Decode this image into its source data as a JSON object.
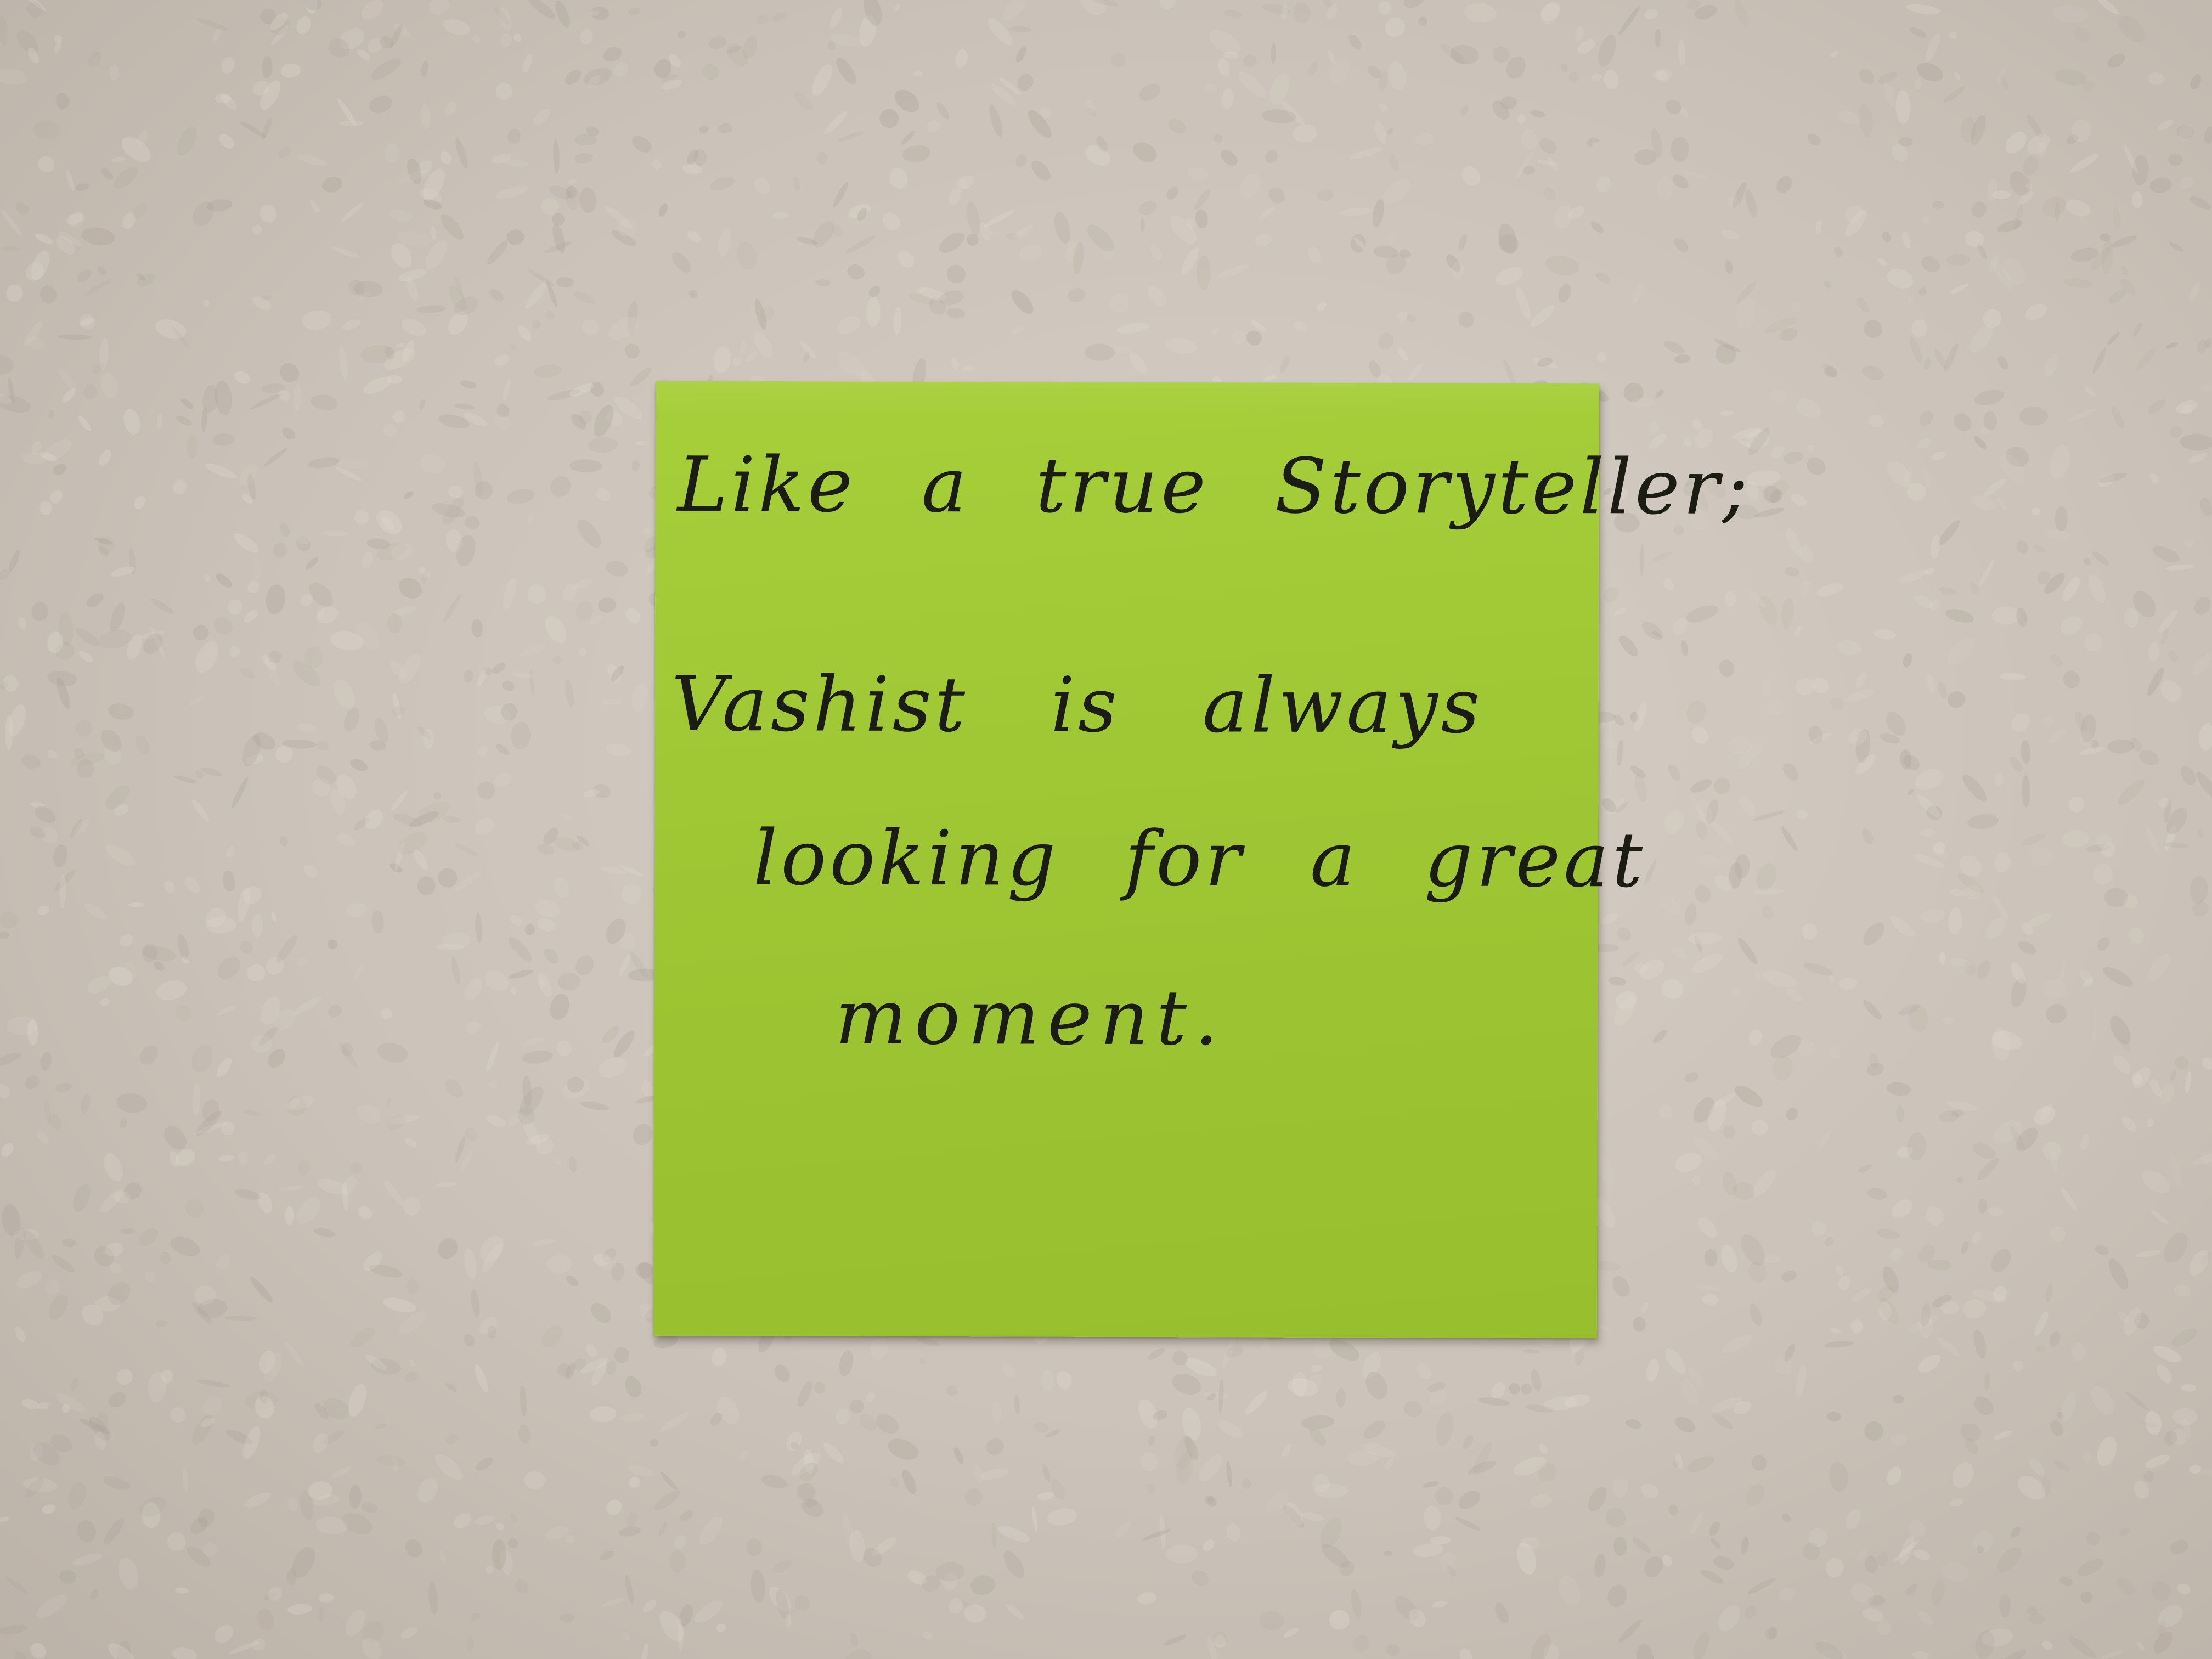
{
  "sticky_note": {
    "color": "#a2ca36",
    "lines": [
      "Like a true Storyteller;",
      "Vashist is always",
      "looking for a great",
      "moment."
    ]
  },
  "wall": {
    "color": "#cec6bc"
  }
}
